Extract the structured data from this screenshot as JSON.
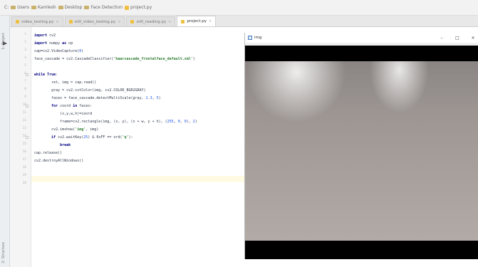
{
  "breadcrumb": [
    {
      "label": "C:"
    },
    {
      "label": "Users"
    },
    {
      "label": "Kamlesh"
    },
    {
      "label": "Desktop"
    },
    {
      "label": "Face Detection"
    },
    {
      "label": "project.py"
    }
  ],
  "tool_strip": {
    "top_label": "1: Project",
    "bottom_label": "2: Structure"
  },
  "tabs": [
    {
      "label": "video_testing.py",
      "active": false
    },
    {
      "label": "still_video_testing.py",
      "active": false
    },
    {
      "label": "still_reading.py",
      "active": false
    },
    {
      "label": "project.py",
      "active": true
    }
  ],
  "editor": {
    "lines": [
      {
        "n": "1",
        "text": "import cv2"
      },
      {
        "n": "2",
        "text": "import numpy as np"
      },
      {
        "n": "3",
        "text": "cap=cv2.VideoCapture(0)"
      },
      {
        "n": "4",
        "text": "face_cascade = cv2.CascadeClassifier('haarcascade_frontalface_default.xml')"
      },
      {
        "n": "5",
        "text": ""
      },
      {
        "n": "6",
        "text": "while True:"
      },
      {
        "n": "7",
        "text": "        ret, img = cap.read()"
      },
      {
        "n": "8",
        "text": "        gray = cv2.cvtColor(img, cv2.COLOR_BGR2GRAY)"
      },
      {
        "n": "9",
        "text": "        faces = face_cascade.detectMultiScale(gray, 1.3, 5)"
      },
      {
        "n": "10",
        "text": "        for coord in faces:"
      },
      {
        "n": "11",
        "text": "            (x,y,w,h)=coord"
      },
      {
        "n": "12",
        "text": "            frame=cv2.rectangle(img, (x, y), (x + w, y + h), (255, 0, 0), 2)"
      },
      {
        "n": "13",
        "text": "        cv2.imshow('img', img)"
      },
      {
        "n": "14",
        "text": "        if cv2.waitKey(25) & 0xFF == ord('q'):"
      },
      {
        "n": "15",
        "text": "            break"
      },
      {
        "n": "16",
        "text": "cap.release()"
      },
      {
        "n": "17",
        "text": "cv2.destroyAllWindows()"
      },
      {
        "n": "18",
        "text": ""
      },
      {
        "n": "19",
        "text": ""
      },
      {
        "n": "20",
        "text": ""
      }
    ]
  },
  "image_window": {
    "title": "img",
    "minimize": "–",
    "maximize": "□",
    "close": "×"
  }
}
